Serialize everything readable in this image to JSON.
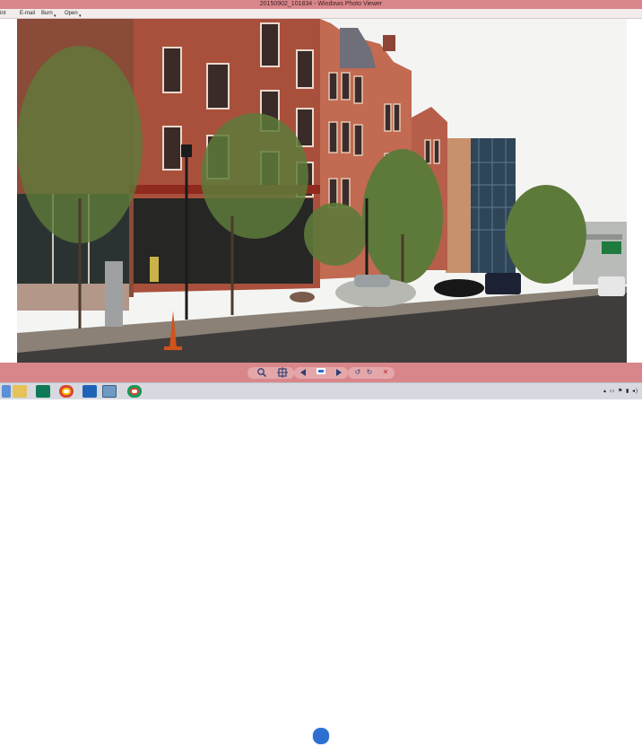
{
  "window": {
    "title": "20150902_101834 - Windows Photo Viewer"
  },
  "menu": {
    "file": "int",
    "email": "E-mail",
    "burn": "Burn",
    "open": "Open"
  },
  "photo": {
    "sign_text": ""
  },
  "controls": {
    "zoom_icon": "magnifier-icon",
    "fit_icon": "fit-window-icon",
    "prev_icon": "previous-icon",
    "slideshow_icon": "slideshow-icon",
    "next_icon": "next-icon",
    "rotate_ccw_icon": "rotate-left-icon",
    "rotate_cw_icon": "rotate-right-icon",
    "delete_icon": "delete-icon",
    "rotate_left_glyph": "↺",
    "rotate_right_glyph": "↻",
    "delete_glyph": "✕"
  },
  "taskbar": {
    "apps": [
      "file-explorer-icon",
      "publisher-icon",
      "chrome-icon",
      "outlook-icon",
      "photo-viewer-icon",
      "chrome-icon"
    ]
  },
  "colors": {
    "title_bar": "#d9868a",
    "taskbar": "#d7d9e0"
  }
}
